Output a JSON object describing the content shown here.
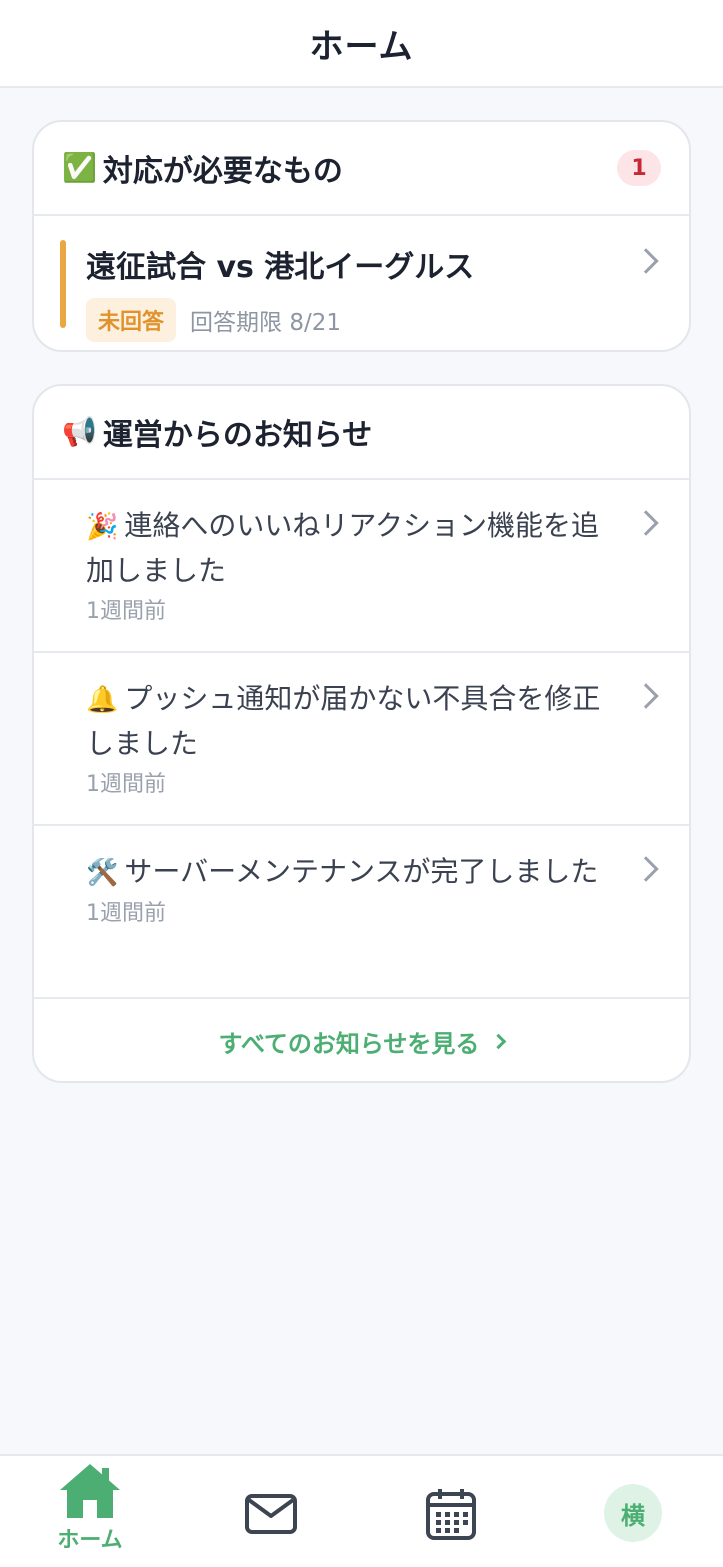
{
  "header": {
    "title": "ホーム"
  },
  "action_card": {
    "icon": "✅",
    "title": "対応が必要なもの",
    "count": "1",
    "items": [
      {
        "title": "遠征試合 vs 港北イーグルス",
        "status": "未回答",
        "deadline": "回答期限 8/21"
      }
    ]
  },
  "news_card": {
    "icon": "📢",
    "title": "運営からのお知らせ",
    "items": [
      {
        "emoji": "🎉",
        "text": "連絡へのいいねリアクション機能を追加しました",
        "time": "1週間前"
      },
      {
        "emoji": "🔔",
        "text": "プッシュ通知が届かない不具合を修正しました",
        "time": "1週間前"
      },
      {
        "emoji": "🛠️",
        "text": "サーバーメンテナンスが完了しました",
        "time": "1週間前"
      }
    ],
    "see_all": "すべてのお知らせを見る"
  },
  "bottom_nav": {
    "home_label": "ホーム",
    "avatar_text": "横",
    "active_color": "#4cae73",
    "icon_color": "#3d4452"
  }
}
